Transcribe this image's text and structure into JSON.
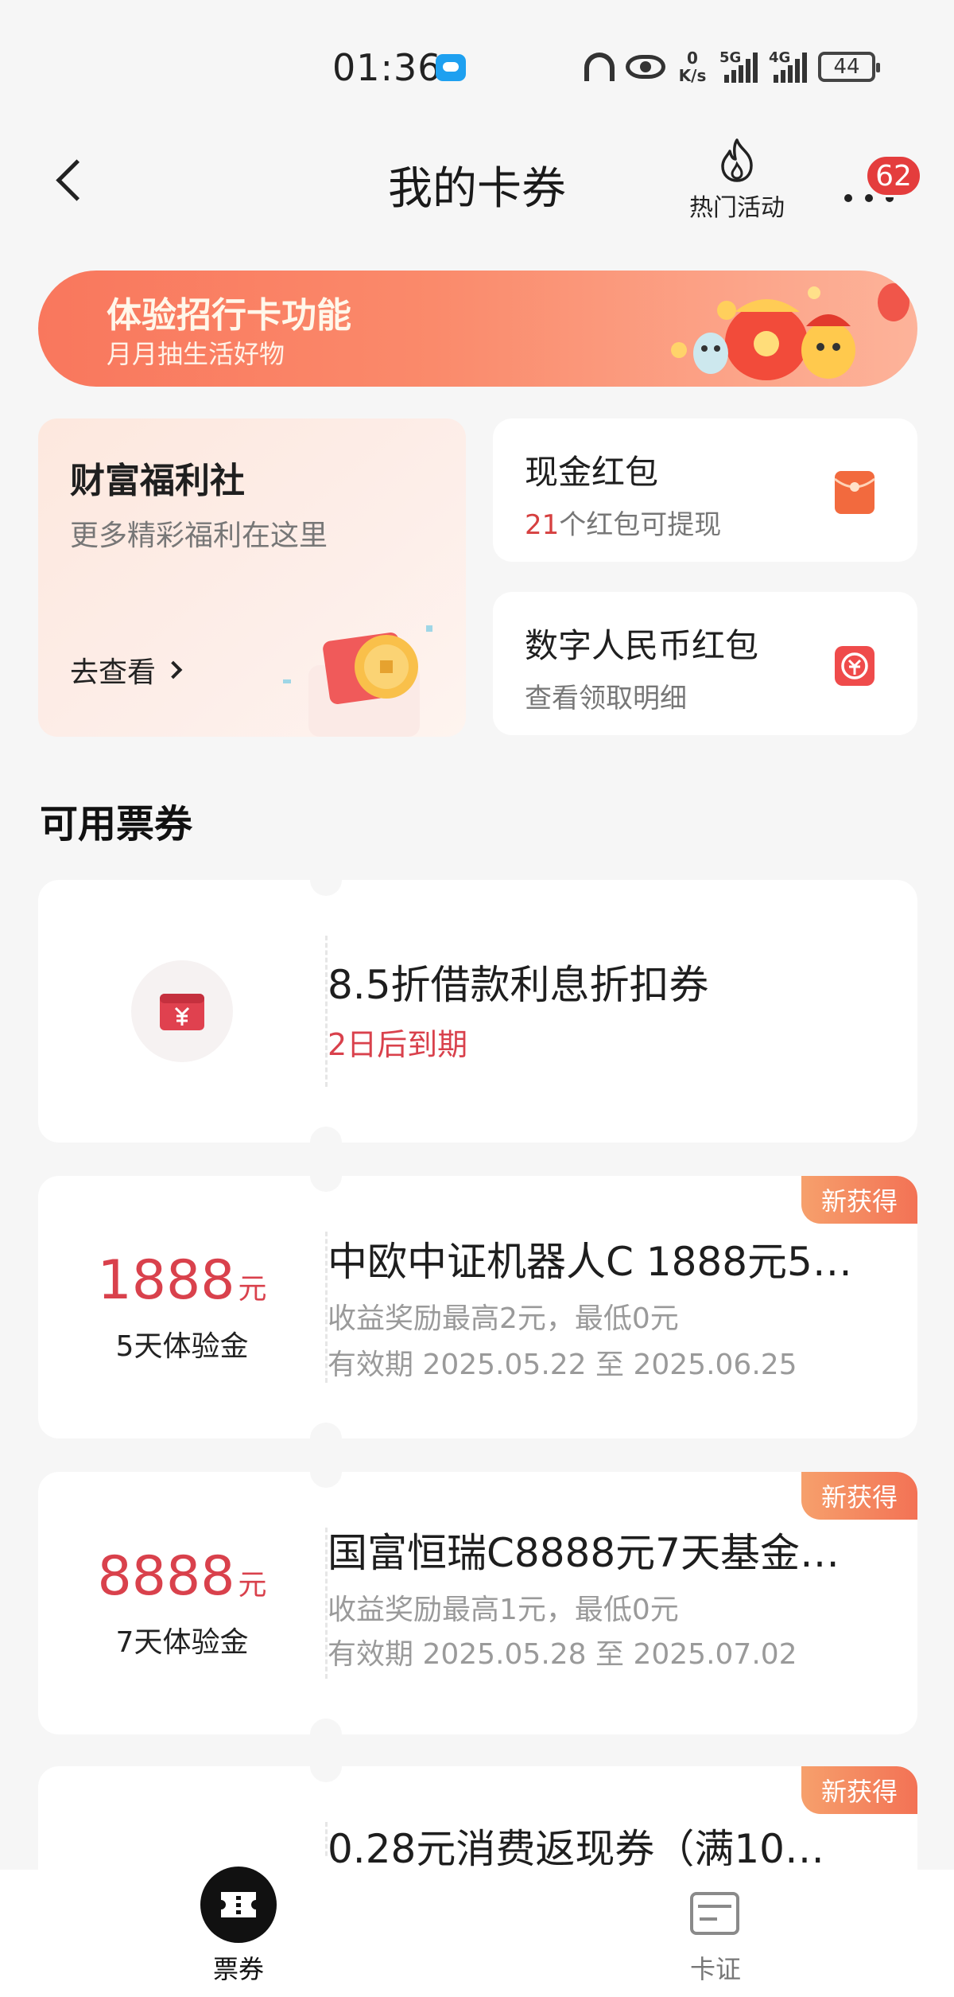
{
  "status_bar": {
    "time": "01:36",
    "net_speed_value": "0",
    "net_speed_unit": "K/s",
    "signal_1": "5G",
    "signal_2": "4G",
    "battery": "44"
  },
  "header": {
    "title": "我的卡券",
    "hot_activity_label": "热门活动",
    "more_badge": "62"
  },
  "banner": {
    "title": "体验招行卡功能",
    "subtitle": "月月抽生活好物"
  },
  "welfare_card": {
    "title": "财富福利社",
    "subtitle": "更多精彩福利在这里",
    "link_label": "去查看"
  },
  "cash_card": {
    "title": "现金红包",
    "count": "21",
    "subtitle_rest": "个红包可提现"
  },
  "ecny_card": {
    "title": "数字人民币红包",
    "subtitle": "查看领取明细"
  },
  "section": {
    "title": "可用票券"
  },
  "coupons": [
    {
      "name": "8.5折借款利息折扣券",
      "expire": "2日后到期"
    },
    {
      "amount": "1888",
      "unit": "元",
      "kind": "5天体验金",
      "name": "中欧中证机器人C 1888元5…",
      "reward": "收益奖励最高2元，最低0元",
      "validity": "有效期 2025.05.22 至 2025.06.25",
      "tag": "新获得"
    },
    {
      "amount": "8888",
      "unit": "元",
      "kind": "7天体验金",
      "name": "国富恒瑞C8888元7天基金…",
      "reward": "收益奖励最高1元，最低0元",
      "validity": "有效期 2025.05.28 至 2025.07.02",
      "tag": "新获得"
    },
    {
      "name": "0.28元消费返现券（满10…",
      "tag": "新获得"
    }
  ],
  "bottom_nav": {
    "coupons_label": "票券",
    "cards_label": "卡证"
  },
  "colors": {
    "accent_red": "#d9414c",
    "badge_red": "#e43d3d",
    "banner_start": "#f9775d",
    "tag_gradient_end": "#f37255",
    "page_bg": "#f6f6f6"
  },
  "icons": [
    "chat-icon",
    "headset-icon",
    "eye-icon",
    "battery-icon",
    "back-icon",
    "flame-icon",
    "more-icon",
    "chevron-right-icon",
    "red-envelope-icon",
    "ecny-icon",
    "yuan-coupon-icon",
    "ticket-icon",
    "card-icon"
  ]
}
